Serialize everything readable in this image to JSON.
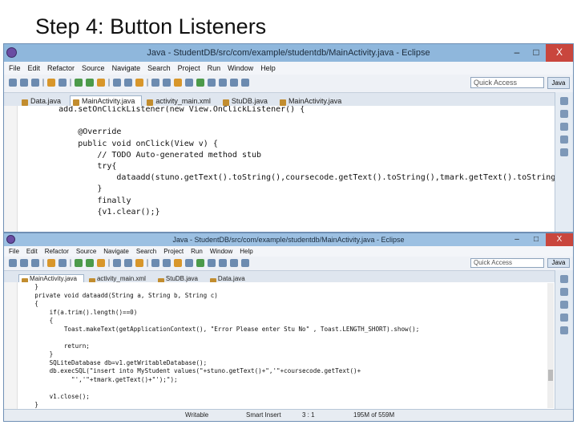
{
  "slide": {
    "title": "Step 4: Button Listeners"
  },
  "window1": {
    "title": "Java - StudentDB/src/com/example/studentdb/MainActivity.java - Eclipse",
    "controls": {
      "minimize": "–",
      "restore": "□",
      "close": "X"
    },
    "menu": [
      "File",
      "Edit",
      "Refactor",
      "Source",
      "Navigate",
      "Search",
      "Project",
      "Run",
      "Window",
      "Help"
    ],
    "quick_access": "Quick Access",
    "perspective": "Java",
    "tabs": [
      "Data.java",
      "MainActivity.java",
      "activity_main.xml",
      "StuDB.java",
      "MainActivity.java"
    ],
    "active_tab": 1,
    "code": "        add.setOnClickListener(new View.OnClickListener() {\n\n            @Override\n            public void onClick(View v) {\n                // TODO Auto-generated method stub\n                try{\n                    dataadd(stuno.getText().toString(),coursecode.getText().toString(),tmark.getText().toString());\n                }\n                finally\n                {v1.clear();}"
  },
  "window2": {
    "title": "Java - StudentDB/src/com/example/studentdb/MainActivity.java - Eclipse",
    "controls": {
      "minimize": "–",
      "restore": "□",
      "close": "X"
    },
    "menu": [
      "File",
      "Edit",
      "Refactor",
      "Source",
      "Navigate",
      "Search",
      "Project",
      "Run",
      "Window",
      "Help"
    ],
    "quick_access": "Quick Access",
    "perspective": "Java",
    "tabs": [
      "MainActivity.java",
      "activity_main.xml",
      "StuDB.java",
      "Data.java"
    ],
    "active_tab": 0,
    "code": "    }\n    private void dataadd(String a, String b, String c)\n    {\n        if(a.trim().length()==0)\n        {\n            Toast.makeText(getApplicationContext(), \"Error Please enter Stu No\" , Toast.LENGTH_SHORT).show();\n\n            return;\n        }\n        SQLiteDatabase db=v1.getWritableDatabase();\n        db.execSQL(\"insert into MyStudent values(\"+stuno.getText()+\",'\"+coursecode.getText()+\n              \"','\"+tmark.getText()+\"');\");\n\n        v1.close();\n    }",
    "status": {
      "mode": "Writable",
      "insert": "Smart Insert",
      "position": "3 : 1",
      "memory": "195M of 559M"
    }
  },
  "colors": {
    "titlebar": "#8fb7dc",
    "close": "#c9463d",
    "editor_bg": "#ffffff"
  }
}
